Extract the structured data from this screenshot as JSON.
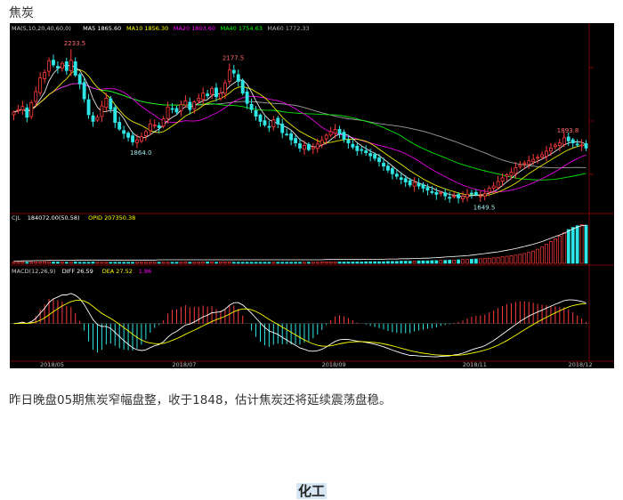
{
  "heading": "焦炭",
  "caption": "昨日晚盘05期焦炭窄幅盘整，收于1848，估计焦炭还将延续震荡盘稳。",
  "section_title": "化工",
  "chart_data": {
    "type": "candlestick",
    "colors": {
      "background": "#000000",
      "up": "#ff3b3b",
      "down": "#2ee6e6",
      "ma5": "#ffffff",
      "ma10": "#ffff00",
      "ma20": "#ff00ff",
      "ma40": "#00ff00",
      "ma60": "#b0b0b0"
    },
    "price_panel": {
      "legend": [
        "MA(5,10,20,40,60,0)",
        "MA5 1865.60",
        "MA10 1856.30",
        "MA20 1803.60",
        "MA40 1754.63",
        "MA60 1772.33"
      ],
      "ylim": [
        1600,
        2300
      ],
      "annotations": [
        {
          "text": "2233.5",
          "value": 2233.5,
          "index": 13
        },
        {
          "text": "1864.0",
          "value": 1864.0,
          "index": 28
        },
        {
          "text": "2177.5",
          "value": 2177.5,
          "index": 49
        },
        {
          "text": "1649.5",
          "value": 1649.5,
          "index": 106
        },
        {
          "text": "1893.8",
          "value": 1893.8,
          "index": 125
        }
      ],
      "closes": [
        1988,
        1998,
        2010,
        1968,
        2025,
        2068,
        2122,
        2142,
        2188,
        2172,
        2160,
        2178,
        2150,
        2190,
        2132,
        2098,
        2040,
        1978,
        1952,
        1968,
        2012,
        2042,
        2000,
        1948,
        1922,
        1905,
        1890,
        1872,
        1880,
        1892,
        1912,
        1942,
        1938,
        1928,
        1962,
        2008,
        2002,
        1988,
        2018,
        2032,
        1998,
        2028,
        2042,
        2062,
        2052,
        2080,
        2048,
        2062,
        2102,
        2152,
        2140,
        2108,
        2062,
        2022,
        1998,
        1972,
        1952,
        1938,
        1932,
        1958,
        1942,
        1908,
        1902,
        1880,
        1868,
        1848,
        1858,
        1842,
        1852,
        1864,
        1878,
        1898,
        1912,
        1920,
        1904,
        1882,
        1868,
        1852,
        1838,
        1842,
        1830,
        1818,
        1808,
        1795,
        1778,
        1762,
        1748,
        1738,
        1726,
        1716,
        1704,
        1714,
        1700,
        1692,
        1684,
        1676,
        1668,
        1674,
        1662,
        1656,
        1662,
        1654,
        1660,
        1668,
        1672,
        1666,
        1662,
        1670,
        1692,
        1700,
        1718,
        1732,
        1744,
        1754,
        1772,
        1782,
        1790,
        1798,
        1804,
        1812,
        1822,
        1836,
        1848,
        1860,
        1868,
        1888,
        1876,
        1868,
        1862,
        1860,
        1848
      ]
    },
    "volume_panel": {
      "legend": [
        "CJL",
        "184072.00(50.58)",
        "OPID 207350.38"
      ],
      "volumes": [
        4,
        4,
        5,
        4,
        4,
        5,
        5,
        6,
        6,
        5,
        5,
        5,
        4,
        4,
        5,
        4,
        4,
        4,
        5,
        4,
        4,
        4,
        4,
        4,
        4,
        4,
        4,
        4,
        4,
        4,
        4,
        4,
        4,
        4,
        4,
        4,
        4,
        4,
        4,
        5,
        4,
        4,
        4,
        5,
        5,
        5,
        4,
        5,
        5,
        5,
        4,
        4,
        4,
        4,
        4,
        4,
        4,
        4,
        4,
        4,
        4,
        4,
        4,
        4,
        4,
        4,
        4,
        4,
        4,
        4,
        5,
        5,
        5,
        5,
        5,
        5,
        5,
        5,
        5,
        5,
        6,
        6,
        6,
        6,
        6,
        7,
        7,
        7,
        8,
        8,
        8,
        8,
        9,
        9,
        9,
        10,
        10,
        11,
        11,
        12,
        12,
        13,
        14,
        14,
        15,
        16,
        17,
        18,
        19,
        20,
        22,
        24,
        26,
        28,
        30,
        33,
        36,
        40,
        45,
        52,
        60,
        70,
        80,
        90,
        100,
        112,
        124,
        132,
        138,
        142,
        140
      ],
      "open_interest": [
        8,
        8,
        9,
        9,
        9,
        10,
        10,
        10,
        11,
        11,
        11,
        11,
        11,
        11,
        12,
        12,
        12,
        12,
        12,
        12,
        12,
        12,
        12,
        12,
        12,
        12,
        12,
        12,
        12,
        12,
        12,
        12,
        12,
        13,
        13,
        13,
        13,
        13,
        13,
        13,
        13,
        13,
        13,
        13,
        13,
        13,
        13,
        13,
        13,
        13,
        13,
        13,
        13,
        13,
        13,
        13,
        13,
        13,
        13,
        13,
        13,
        13,
        13,
        13,
        13,
        13,
        13,
        13,
        13,
        13,
        13,
        14,
        14,
        14,
        14,
        14,
        14,
        14,
        14,
        14,
        15,
        15,
        15,
        15,
        15,
        16,
        16,
        16,
        17,
        17,
        17,
        18,
        18,
        19,
        19,
        20,
        21,
        22,
        23,
        24,
        25,
        26,
        27,
        28,
        30,
        32,
        34,
        36,
        38,
        40,
        42,
        45,
        48,
        51,
        54,
        58,
        62,
        66,
        70,
        75,
        80,
        86,
        92,
        98,
        104,
        110,
        118,
        126,
        133,
        138,
        140
      ],
      "ylim": [
        0,
        150
      ]
    },
    "macd_panel": {
      "legend": [
        "MACD(12,26,9)",
        "DIFF 26.59",
        "DEA 27.52",
        "1.86"
      ],
      "ylim": [
        -60,
        80
      ]
    },
    "x_ticks": [
      {
        "label": "2018/05",
        "index": 8
      },
      {
        "label": "2018/07",
        "index": 38
      },
      {
        "label": "2018/09",
        "index": 72
      },
      {
        "label": "2018/11",
        "index": 104
      },
      {
        "label": "2018/12",
        "index": 128
      }
    ]
  }
}
